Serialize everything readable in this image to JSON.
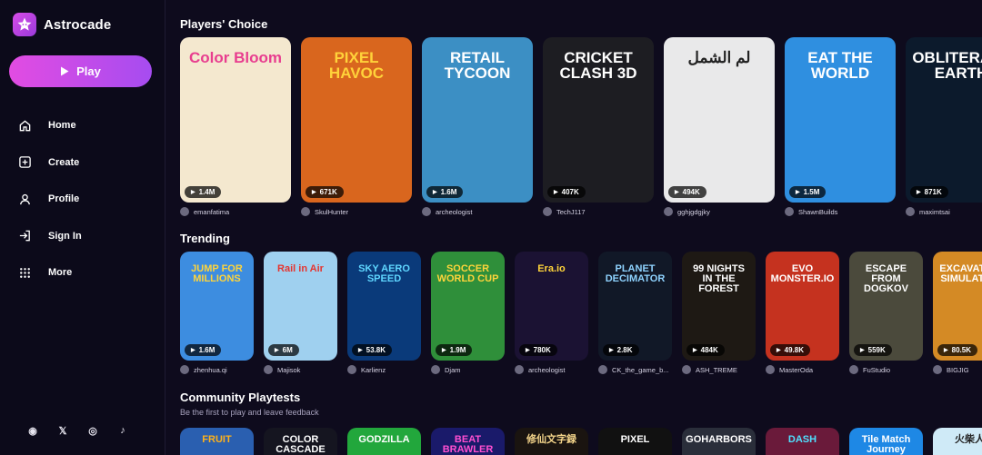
{
  "app": {
    "name": "Astrocade"
  },
  "play_button": {
    "label": "Play"
  },
  "nav": [
    {
      "label": "Home",
      "icon": "home-icon"
    },
    {
      "label": "Create",
      "icon": "plus-square-icon"
    },
    {
      "label": "Profile",
      "icon": "user-icon"
    },
    {
      "label": "Sign In",
      "icon": "sign-in-icon"
    },
    {
      "label": "More",
      "icon": "grid-icon"
    }
  ],
  "socials": [
    {
      "icon": "discord-icon",
      "glyph": "◉"
    },
    {
      "icon": "x-icon",
      "glyph": "𝕏"
    },
    {
      "icon": "instagram-icon",
      "glyph": "◎"
    },
    {
      "icon": "tiktok-icon",
      "glyph": "♪"
    }
  ],
  "players_choice": {
    "title": "Players' Choice",
    "games": [
      {
        "title": "Color Bloom",
        "plays": "1.4M",
        "author": "emanfatima",
        "bg": "#f4e8cf",
        "fg": "#e83d8f"
      },
      {
        "title": "PIXEL HAVOC",
        "plays": "671K",
        "author": "SkulHunter",
        "bg": "#d9661e",
        "fg": "#ffd23a"
      },
      {
        "title": "RETAIL TYCOON",
        "plays": "1.6M",
        "author": "archeologist",
        "bg": "#3c8fc4",
        "fg": "#ffffff"
      },
      {
        "title": "CRICKET CLASH 3D",
        "plays": "407K",
        "author": "TechJ117",
        "bg": "#1d1d22",
        "fg": "#ffffff"
      },
      {
        "title": "لم الشمل",
        "plays": "494K",
        "author": "gghjgdgjky",
        "bg": "#e9e9ea",
        "fg": "#222222"
      },
      {
        "title": "EAT THE WORLD",
        "plays": "1.5M",
        "author": "ShawnBuilds",
        "bg": "#2f8fe0",
        "fg": "#ffffff"
      },
      {
        "title": "OBLITERATE EARTH",
        "plays": "871K",
        "author": "maximtsai",
        "bg": "#0c1a2c",
        "fg": "#ffffff"
      }
    ]
  },
  "trending": {
    "title": "Trending",
    "games": [
      {
        "title": "JUMP FOR MILLIONS",
        "plays": "1.6M",
        "author": "zhenhua.qi",
        "bg": "#3d8de0",
        "fg": "#ffd43a"
      },
      {
        "title": "Rail in Air",
        "plays": "6M",
        "author": "Majisok",
        "bg": "#9fd0ef",
        "fg": "#e5342f"
      },
      {
        "title": "SKY AERO SPEED",
        "plays": "53.8K",
        "author": "Karlienz",
        "bg": "#0a3a7a",
        "fg": "#5fd6ff"
      },
      {
        "title": "SOCCER WORLD CUP",
        "plays": "1.9M",
        "author": "Djam",
        "bg": "#2f8f3a",
        "fg": "#ffd43a"
      },
      {
        "title": "Era.io",
        "plays": "780K",
        "author": "archeologist",
        "bg": "#1b1233",
        "fg": "#ffd43a"
      },
      {
        "title": "PLANET DECIMATOR",
        "plays": "2.8K",
        "author": "CK_the_game_b...",
        "bg": "#111827",
        "fg": "#8fd3ff"
      },
      {
        "title": "99 NIGHTS IN THE FOREST",
        "plays": "484K",
        "author": "ASH_TREME",
        "bg": "#1e1914",
        "fg": "#ffffff"
      },
      {
        "title": "EVO MONSTER.IO",
        "plays": "49.8K",
        "author": "MasterOda",
        "bg": "#c5321f",
        "fg": "#ffffff"
      },
      {
        "title": "ESCAPE FROM DOGKOV",
        "plays": "559K",
        "author": "FuStudio",
        "bg": "#4b4a3c",
        "fg": "#ffffff"
      },
      {
        "title": "EXCAVATOR SIMULATOR",
        "plays": "80.5K",
        "author": "BIGJIG",
        "bg": "#d48a25",
        "fg": "#ffffff"
      }
    ]
  },
  "community": {
    "title": "Community Playtests",
    "subtitle": "Be the first to play and leave feedback",
    "games": [
      {
        "title": "FRUIT",
        "bg": "#2a5fb0",
        "fg": "#ffb21a"
      },
      {
        "title": "COLOR CASCADE",
        "bg": "#151520",
        "fg": "#ffffff"
      },
      {
        "title": "GODZILLA",
        "bg": "#22a73c",
        "fg": "#ffffff"
      },
      {
        "title": "BEAT BRAWLER",
        "bg": "#1a1a6a",
        "fg": "#ff4fd1"
      },
      {
        "title": "修仙文字録",
        "bg": "#1a1410",
        "fg": "#f3d48a"
      },
      {
        "title": "PIXEL",
        "bg": "#111111",
        "fg": "#ffffff"
      },
      {
        "title": "GOHARBORS",
        "bg": "#2a2e3a",
        "fg": "#ffffff"
      },
      {
        "title": "DASH",
        "bg": "#6a1a3a",
        "fg": "#4fe0ff"
      },
      {
        "title": "Tile Match Journey",
        "bg": "#1e88e5",
        "fg": "#ffffff"
      },
      {
        "title": "火柴人",
        "bg": "#cfeaf7",
        "fg": "#222222"
      }
    ]
  }
}
